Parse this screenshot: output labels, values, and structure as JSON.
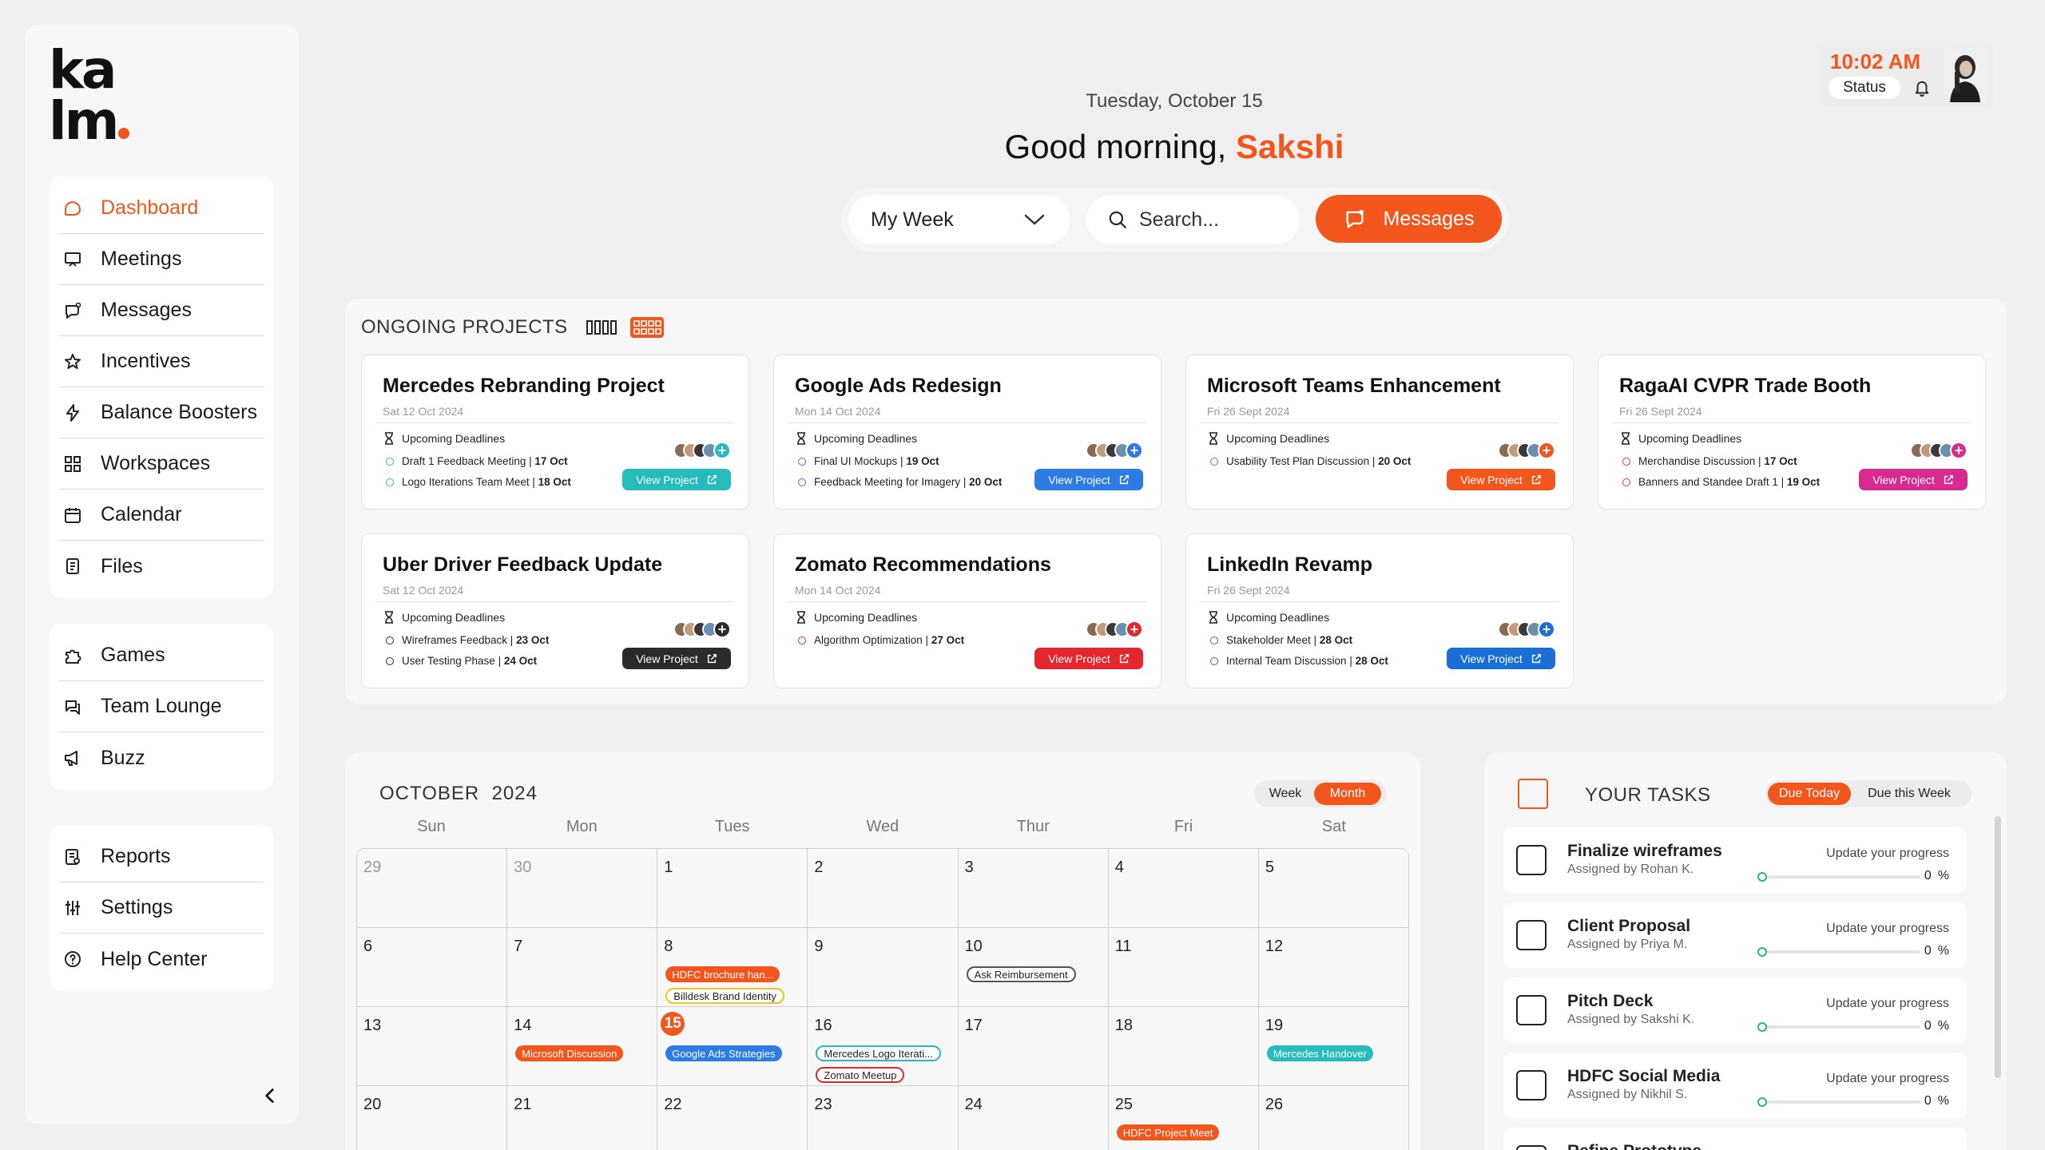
{
  "colors": {
    "accent": "#f2561d",
    "teal": "#26bcbb",
    "blue": "#2d7be4",
    "red": "#e5262d",
    "magenta": "#d92a8f",
    "dark": "#2b2b2b",
    "navy": "#1a6fd6"
  },
  "logo": {
    "line1": "ka",
    "line2": "lm"
  },
  "nav": {
    "main": [
      {
        "label": "Dashboard",
        "icon": "dashboard-icon"
      },
      {
        "label": "Meetings",
        "icon": "presentation-icon"
      },
      {
        "label": "Messages",
        "icon": "chat-icon"
      },
      {
        "label": "Incentives",
        "icon": "star-icon"
      },
      {
        "label": "Balance Boosters",
        "icon": "lightning-icon"
      },
      {
        "label": "Workspaces",
        "icon": "grid-icon"
      },
      {
        "label": "Calendar",
        "icon": "calendar-icon"
      },
      {
        "label": "Files",
        "icon": "file-icon"
      }
    ],
    "social": [
      {
        "label": "Games",
        "icon": "puzzle-icon"
      },
      {
        "label": "Team Lounge",
        "icon": "lounge-icon"
      },
      {
        "label": "Buzz",
        "icon": "megaphone-icon"
      }
    ],
    "footer": [
      {
        "label": "Reports",
        "icon": "report-icon"
      },
      {
        "label": "Settings",
        "icon": "sliders-icon"
      },
      {
        "label": "Help Center",
        "icon": "help-icon"
      }
    ]
  },
  "header": {
    "date": "Tuesday, October 15",
    "greeting": "Good morning, ",
    "user": "Sakshi",
    "week_select": "My Week",
    "search_placeholder": "Search...",
    "messages_label": "Messages",
    "time": "10:02 AM",
    "status_label": "Status"
  },
  "projects": {
    "title": "ONGOING PROJECTS",
    "upcoming_label": "Upcoming Deadlines",
    "view_label": "View Project",
    "cards": [
      {
        "title": "Mercedes Rebranding Project",
        "date": "Sat  12 Oct 2024",
        "color": "#26bcbb",
        "deadlines": [
          {
            "text": "Draft 1 Feedback Meeting | ",
            "date": "17 Oct"
          },
          {
            "text": "Logo Iterations Team Meet | ",
            "date": "18 Oct"
          }
        ]
      },
      {
        "title": "Google Ads Redesign",
        "date": "Mon  14 Oct 2024",
        "color": "#2d7be4",
        "deadlines": [
          {
            "text": "Final UI Mockups | ",
            "date": "19 Oct"
          },
          {
            "text": "Feedback Meeting for Imagery | ",
            "date": "20 Oct"
          }
        ]
      },
      {
        "title": "Microsoft Teams Enhancement",
        "date": "Fri  26 Sept 2024",
        "color": "#f2561d",
        "deadlines": [
          {
            "text": "Usability Test Plan Discussion | ",
            "date": "20 Oct"
          }
        ]
      },
      {
        "title": "RagaAI CVPR Trade Booth",
        "date": "Fri  26 Sept 2024",
        "color": "#d92a8f",
        "deadlines": [
          {
            "text": "Merchandise Discussion | ",
            "date": "17 Oct"
          },
          {
            "text": "Banners and Standee Draft 1 | ",
            "date": "19 Oct"
          }
        ]
      },
      {
        "title": "Uber Driver Feedback Update",
        "date": "Sat  12 Oct 2024",
        "color": "#2b2b2b",
        "deadlines": [
          {
            "text": "Wireframes Feedback | ",
            "date": "23 Oct"
          },
          {
            "text": "User Testing Phase | ",
            "date": "24 Oct"
          }
        ]
      },
      {
        "title": "Zomato Recommendations",
        "date": "Mon  14 Oct 2024",
        "color": "#e5262d",
        "deadlines": [
          {
            "text": "Algorithm Optimization | ",
            "date": "27 Oct"
          }
        ]
      },
      {
        "title": "LinkedIn Revamp",
        "date": "Fri  26 Sept 2024",
        "color": "#1a6fd6",
        "deadlines": [
          {
            "text": "Stakeholder Meet | ",
            "date": "28 Oct"
          },
          {
            "text": "Internal Team Discussion | ",
            "date": "28 Oct"
          }
        ]
      }
    ]
  },
  "calendar": {
    "title": "OCTOBER  2024",
    "week_label": "Week",
    "month_label": "Month",
    "days_of_week": [
      "Sun",
      "Mon",
      "Tues",
      "Wed",
      "Thur",
      "Fri",
      "Sat"
    ],
    "weeks": [
      [
        {
          "n": "29",
          "muted": true
        },
        {
          "n": "30",
          "muted": true
        },
        {
          "n": "1"
        },
        {
          "n": "2"
        },
        {
          "n": "3"
        },
        {
          "n": "4"
        },
        {
          "n": "5"
        }
      ],
      [
        {
          "n": "6"
        },
        {
          "n": "7"
        },
        {
          "n": "8",
          "events": [
            {
              "label": "HDFC brochure han...",
              "style": "fill",
              "color": "#f2561d"
            },
            {
              "label": "Billdesk Brand Identity",
              "style": "outline",
              "color": "#f0c419"
            }
          ]
        },
        {
          "n": "9"
        },
        {
          "n": "10",
          "events": [
            {
              "label": "Ask Reimbursement",
              "style": "outline",
              "color": "#555555"
            }
          ]
        },
        {
          "n": "11"
        },
        {
          "n": "12"
        }
      ],
      [
        {
          "n": "13"
        },
        {
          "n": "14",
          "events": [
            {
              "label": "Microsoft Discussion",
              "style": "fill",
              "color": "#f2561d"
            }
          ]
        },
        {
          "n": "15",
          "today": true,
          "events": [
            {
              "label": "Google Ads Strategies",
              "style": "fill",
              "color": "#2d7be4"
            }
          ]
        },
        {
          "n": "16",
          "events": [
            {
              "label": "Mercedes Logo Iterati...",
              "style": "outline",
              "color": "#26bcbb"
            },
            {
              "label": "Zomato Meetup",
              "style": "outline",
              "color": "#e5262d"
            }
          ]
        },
        {
          "n": "17"
        },
        {
          "n": "18"
        },
        {
          "n": "19",
          "events": [
            {
              "label": "Mercedes Handover",
              "style": "fill",
              "color": "#26bcbb"
            }
          ]
        }
      ],
      [
        {
          "n": "20"
        },
        {
          "n": "21"
        },
        {
          "n": "22"
        },
        {
          "n": "23"
        },
        {
          "n": "24"
        },
        {
          "n": "25",
          "events": [
            {
              "label": "HDFC Project Meet",
              "style": "fill",
              "color": "#f2561d"
            }
          ]
        },
        {
          "n": "26"
        }
      ]
    ]
  },
  "tasks": {
    "title": "YOUR TASKS",
    "due_today": "Due Today",
    "due_week": "Due this Week",
    "update_label": "Update your progress",
    "items": [
      {
        "name": "Finalize wireframes",
        "assigned": "Assigned by Rohan K.",
        "progress": "0",
        "unit": "%"
      },
      {
        "name": "Client Proposal",
        "assigned": "Assigned by Priya M.",
        "progress": "0",
        "unit": "%"
      },
      {
        "name": "Pitch Deck",
        "assigned": "Assigned by Sakshi K.",
        "progress": "0",
        "unit": "%"
      },
      {
        "name": "HDFC Social Media",
        "assigned": "Assigned by Nikhil S.",
        "progress": "0",
        "unit": "%"
      },
      {
        "name": "Refine Prototype",
        "assigned": "",
        "progress": "",
        "unit": ""
      }
    ]
  }
}
